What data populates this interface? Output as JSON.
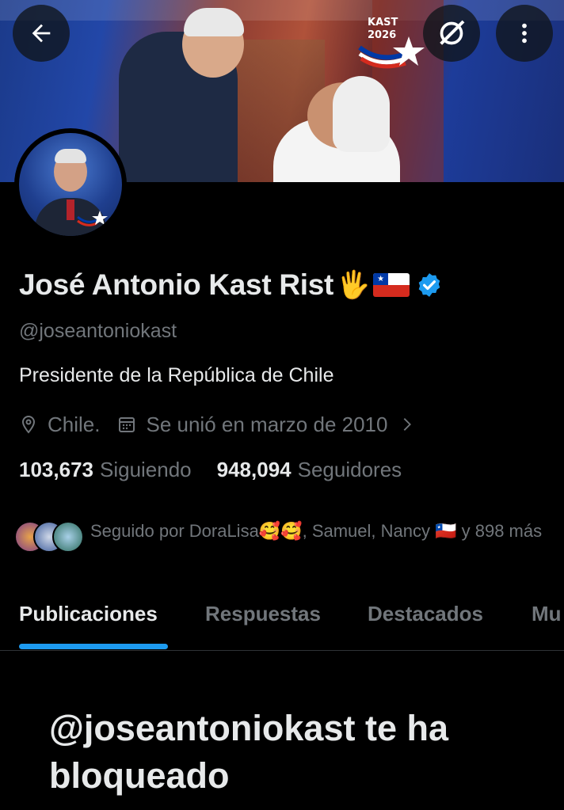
{
  "banner": {
    "logo_line1": "KAST",
    "logo_line2": "2026"
  },
  "header": {
    "back_icon": "arrow-left-icon",
    "grok_icon": "grok-icon",
    "more_icon": "vertical-dots-icon"
  },
  "profile": {
    "name": "José Antonio Kast Rist",
    "name_emoji": "🖐️",
    "handle": "@joseantoniokast",
    "bio": "Presidente de la República de Chile",
    "location": "Chile.",
    "joined": "Se unió en marzo de 2010",
    "following_count": "103,673",
    "following_label": "Siguiendo",
    "followers_count": "948,094",
    "followers_label": "Seguidores",
    "followed_by": "Seguido por DoraLisa🥰🥰, Samuel, Nancy 🇨🇱 y 898 más"
  },
  "colors": {
    "accent": "#1d9bf0",
    "muted": "#71767b",
    "text": "#e7e9ea",
    "background": "#000000"
  },
  "tabs": [
    {
      "label": "Publicaciones",
      "active": true
    },
    {
      "label": "Respuestas",
      "active": false
    },
    {
      "label": "Destacados",
      "active": false
    },
    {
      "label": "Mu",
      "active": false
    }
  ],
  "blocked_message": "@joseantoniokast te ha bloqueado"
}
